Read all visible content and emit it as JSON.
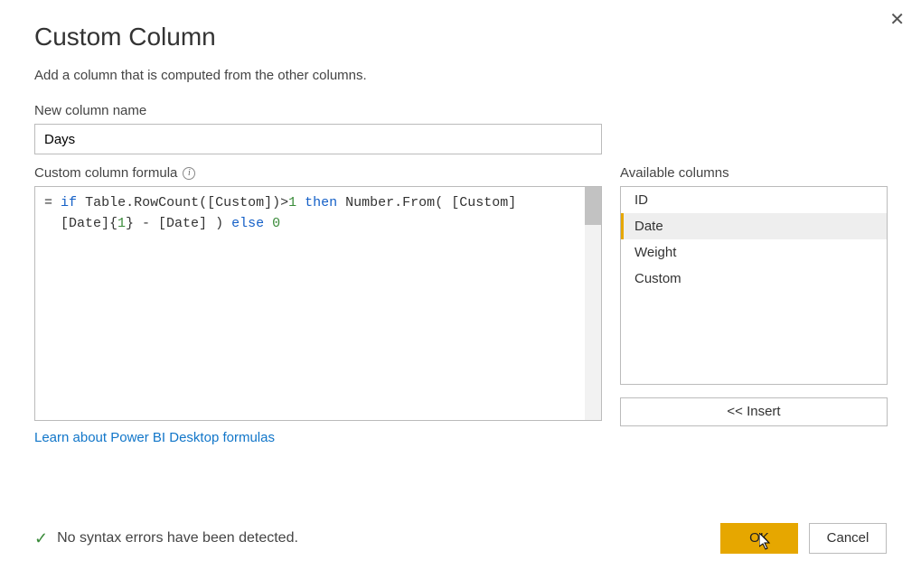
{
  "dialog": {
    "title": "Custom Column",
    "subtitle": "Add a column that is computed from the other columns.",
    "close_symbol": "✕"
  },
  "new_column": {
    "label": "New column name",
    "value": "Days"
  },
  "formula": {
    "label": "Custom column formula",
    "tokens": {
      "eq": "=",
      "if": "if",
      "fn1": "Table.RowCount([Custom])>",
      "num1": "1",
      "then": "then",
      "fn2": "Number.From( [Custom]",
      "line2a": "[Date]{",
      "num2": "1",
      "line2b": "} - [Date] )",
      "else": "else",
      "num3": "0"
    }
  },
  "available": {
    "label": "Available columns",
    "items": [
      "ID",
      "Date",
      "Weight",
      "Custom"
    ],
    "selected_index": 1,
    "insert_label": "<< Insert"
  },
  "learn_link": "Learn about Power BI Desktop formulas",
  "status": {
    "text": "No syntax errors have been detected."
  },
  "buttons": {
    "ok": "OK",
    "cancel": "Cancel"
  }
}
